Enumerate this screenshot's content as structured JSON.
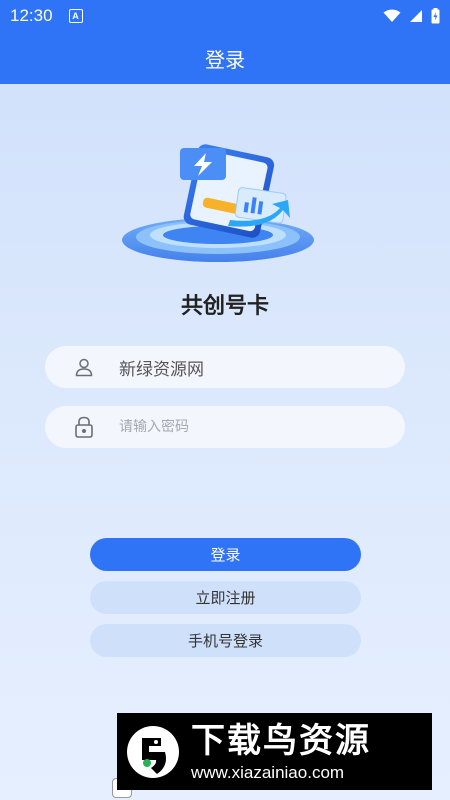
{
  "status_bar": {
    "time": "12:30",
    "notification_badge": "A"
  },
  "header": {
    "title": "登录"
  },
  "app": {
    "name": "共创号卡"
  },
  "form": {
    "username_value": "新绿资源网",
    "password_placeholder": "请输入密码"
  },
  "buttons": {
    "login": "登录",
    "register": "立即注册",
    "phone_login": "手机号登录"
  },
  "watermark": {
    "title": "下载鸟资源",
    "url": "www.xiazainiao.com"
  },
  "colors": {
    "primary": "#2f73f6",
    "secondary_button": "#cfe1fa",
    "field_bg": "#f3f6fc"
  },
  "icons": {
    "user": "user-icon",
    "lock": "lock-icon",
    "wifi": "wifi-icon",
    "signal": "signal-icon",
    "battery": "battery-icon"
  }
}
